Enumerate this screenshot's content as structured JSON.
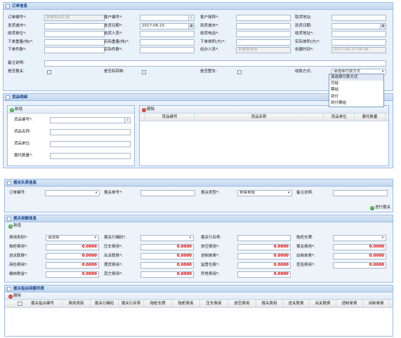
{
  "order": {
    "title": "订单信息",
    "rows": [
      [
        {
          "label": "订单编号*:",
          "value": "系统自动生成",
          "type": "dis"
        },
        {
          "label": "客户编号*:",
          "value": "",
          "type": "search"
        },
        {
          "label": "客户简称*:",
          "value": "",
          "type": "text"
        },
        {
          "label": "取货地址:",
          "value": "",
          "type": "text"
        }
      ],
      [
        {
          "label": "发货城市*:",
          "value": "",
          "type": "text"
        },
        {
          "label": "发货日期*:",
          "value": "2017-08-23",
          "type": "date"
        },
        {
          "label": "到货城市*:",
          "value": "",
          "type": "text"
        },
        {
          "label": "到货日期:",
          "value": "",
          "type": "date"
        }
      ],
      [
        {
          "label": "收货单位*:",
          "value": "",
          "type": "text"
        },
        {
          "label": "收货人员*:",
          "value": "",
          "type": "text"
        },
        {
          "label": "收货电话*:",
          "value": "",
          "type": "text"
        },
        {
          "label": "收货地址*:",
          "value": "",
          "type": "text"
        }
      ],
      [
        {
          "label": "下单重量(吨)*:",
          "value": "",
          "type": "text"
        },
        {
          "label": "实际重量(吨)*:",
          "value": "",
          "type": "text"
        },
        {
          "label": "下单体积(方)*:",
          "value": "",
          "type": "text"
        },
        {
          "label": "实际体积(方)*:",
          "value": "",
          "type": "text"
        }
      ],
      [
        {
          "label": "下单件数*:",
          "value": "",
          "type": "text"
        },
        {
          "label": "实际件数*:",
          "value": "",
          "type": "text"
        },
        {
          "label": "经办人员*:",
          "value": "系统管理员",
          "type": "dis"
        },
        {
          "label": "创建时间*:",
          "value": "2017-08-23 09:36",
          "type": "dis"
        }
      ]
    ],
    "remark_label": "备注说明:",
    "check_labels": [
      "是否报关:",
      "是否有回单:",
      "是否整车:"
    ],
    "payment_label": "收款方式:",
    "payment_selected": "请选择付款方式",
    "payment_options": [
      "请选择付款方式",
      "月结",
      "票结",
      "到付",
      "到付票结"
    ]
  },
  "goods": {
    "title": "货品明细",
    "add_label": "新增",
    "delete_label": "删除",
    "form": [
      {
        "label": "货品编号*:",
        "type": "search"
      },
      {
        "label": "货品名称:",
        "type": "text"
      },
      {
        "label": "货品单位:",
        "type": "text"
      },
      {
        "label": "委托数量*:",
        "type": "text"
      }
    ],
    "columns": [
      "货品编号",
      "货品名称",
      "货品单位",
      "委托数量"
    ]
  },
  "customs_head": {
    "title": "报关头表信息",
    "fields": [
      {
        "label": "订单编号:",
        "type": "combo",
        "value": ""
      },
      {
        "label": "报关单号*:",
        "type": "text",
        "value": ""
      },
      {
        "label": "报关类型*:",
        "type": "combo",
        "value": "单票单报"
      },
      {
        "label": "备注说明:",
        "type": "text",
        "value": ""
      }
    ],
    "action_label": "进行报关"
  },
  "customs_detail": {
    "title": "报关用额信息",
    "add_label": "新增",
    "rows": [
      [
        {
          "label": "费用类别*:",
          "type": "combo",
          "value": "请选择"
        },
        {
          "label": "报关行编码*:",
          "type": "combo",
          "value": ""
        },
        {
          "label": "报关行名称:",
          "type": "text",
          "value": ""
        },
        {
          "label": "拖柜车牌:",
          "type": "combo",
          "value": ""
        }
      ],
      [
        {
          "label": "拖柜费用*:",
          "type": "num",
          "value": "0.0000"
        },
        {
          "label": "压车费用*:",
          "type": "num",
          "value": "0.0000"
        },
        {
          "label": "放空费用*:",
          "type": "num",
          "value": "0.0000"
        },
        {
          "label": "报关费用*:",
          "type": "num",
          "value": "0.0000"
        }
      ],
      [
        {
          "label": "进关联费*:",
          "type": "num",
          "value": "0.0000"
        },
        {
          "label": "出关联费*:",
          "type": "num",
          "value": "0.0000"
        },
        {
          "label": "进制单费*:",
          "type": "num",
          "value": "0.0000"
        },
        {
          "label": "出制单费*:",
          "type": "num",
          "value": "0.0000"
        }
      ],
      [
        {
          "label": "商检费用*:",
          "type": "num",
          "value": "0.0000"
        },
        {
          "label": "理货费用*:",
          "type": "num",
          "value": "0.0000"
        },
        {
          "label": "监管仓费*:",
          "type": "num",
          "value": "0.0000"
        },
        {
          "label": "查验费用*:",
          "type": "num",
          "value": "0.0000"
        }
      ],
      [
        {
          "label": "缴纳税金*:",
          "type": "num",
          "value": "0.0000"
        },
        {
          "label": "其它费用*:",
          "type": "num",
          "value": "0.0000"
        },
        {
          "label": "异常费用*:",
          "type": "num",
          "value": "0.0000"
        }
      ]
    ]
  },
  "customs_list": {
    "title": "报关指派用额列表",
    "delete_label": "删除",
    "columns": [
      "报关指派编号",
      "费用类别",
      "报关行编码",
      "报关行名称",
      "拖柜车牌",
      "拖柜费用",
      "压车费用",
      "放空费用",
      "报关费用",
      "进关联费",
      "出关联费",
      "进制单费",
      "出制单费"
    ]
  }
}
